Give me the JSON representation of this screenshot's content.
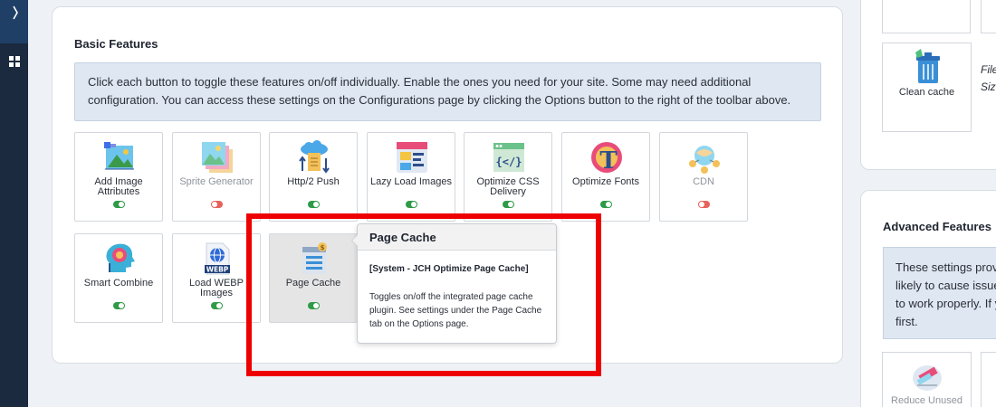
{
  "basic": {
    "title": "Basic Features",
    "info": "Click each button to toggle these features on/off individually. Enable the ones you need for your site. Some may need additional configuration. You can access these settings on the Configurations page by clicking the Options button to the right of the toolbar above.",
    "features": [
      {
        "label": "Add Image Attributes",
        "state": "on"
      },
      {
        "label": "Sprite Generator",
        "state": "off"
      },
      {
        "label": "Http/2 Push",
        "state": "on"
      },
      {
        "label": "Lazy Load Images",
        "state": "on"
      },
      {
        "label": "Optimize CSS Delivery",
        "state": "on"
      },
      {
        "label": "Optimize Fonts",
        "state": "on"
      },
      {
        "label": "CDN",
        "state": "off"
      },
      {
        "label": "Smart Combine",
        "state": "on"
      },
      {
        "label": "Load WEBP Images",
        "state": "on"
      },
      {
        "label": "Page Cache",
        "state": "on"
      }
    ]
  },
  "popover": {
    "title": "Page Cache",
    "plugin": "[System - JCH Optimize Page Cache]",
    "description": "Toggles on/off the integrated page cache plugin. See settings under the Page Cache tab on the Options page."
  },
  "right": {
    "clean_cache_label": "Clean cache",
    "file_info_line1": "File",
    "file_info_line2": "Siz",
    "advanced_title": "Advanced Features",
    "advanced_info_lines": [
      "These settings prov",
      "likely to cause issue",
      "to work properly. If y",
      "first."
    ],
    "reduce_label": "Reduce Unused"
  },
  "icons": {
    "webp_badge": "WEBP",
    "fonts_letter": "T",
    "css_glyph": "{</}"
  },
  "colors": {
    "toggle_on": "#2e9b47",
    "toggle_off": "#e7625a",
    "highlight": "#ee0000",
    "sidebar": "#1b2a3e"
  }
}
